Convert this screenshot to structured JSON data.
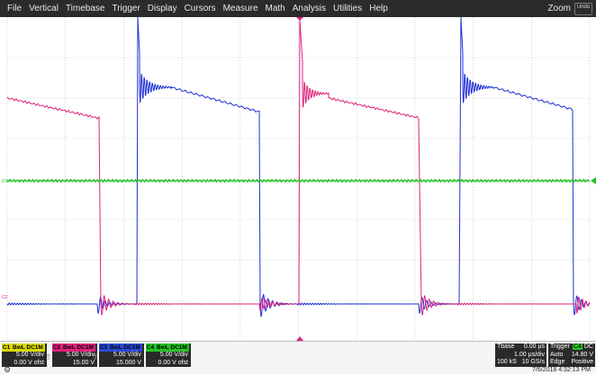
{
  "menu": {
    "items": [
      "File",
      "Vertical",
      "Timebase",
      "Trigger",
      "Display",
      "Cursors",
      "Measure",
      "Math",
      "Analysis",
      "Utilities",
      "Help"
    ],
    "zoom_label": "Zoom",
    "undo_label": "Undo"
  },
  "waveforms": {
    "colors": {
      "ch1": "#d9d900",
      "ch2": "#e0217a",
      "ch3": "#1e2fd6",
      "ch4": "#22c422",
      "grid": "#b8b8b8"
    },
    "ch4_marker": "C4",
    "ch2_marker": "C2"
  },
  "channels": [
    {
      "id": "ch1",
      "num": "C1",
      "coupling": "BwL DC1M",
      "scale": "5.00 V/div",
      "offset": "0.00 V ofst",
      "color": "#d9d900"
    },
    {
      "id": "ch2",
      "num": "C2",
      "coupling": "BwL DC1M",
      "scale": "5.00 V/div",
      "offset": "15.00 V",
      "color": "#e0217a"
    },
    {
      "id": "ch3",
      "num": "C3",
      "coupling": "BwL DC1M",
      "scale": "5.00 V/div",
      "offset": "15.000 V",
      "color": "#2a4bd6"
    },
    {
      "id": "ch4",
      "num": "C4",
      "coupling": "BwL DC1M",
      "scale": "5.00 V/div",
      "offset": "0.00 V ofst",
      "color": "#22c422"
    }
  ],
  "timebase": {
    "label": "Tbase",
    "delay": "0.00 µs",
    "per_div": "1.00 µs/div",
    "samples": "100 kS",
    "rate": "10 GS/s"
  },
  "trigger": {
    "label": "Trigger",
    "source": "C4",
    "coupling": "DC",
    "mode": "Auto",
    "level": "14.80 V",
    "type": "Edge",
    "slope": "Positive"
  },
  "datetime": "7/6/2018 4:32:13 PM"
}
